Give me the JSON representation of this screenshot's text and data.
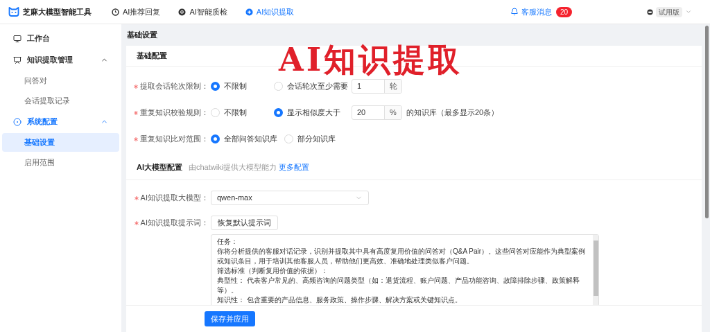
{
  "brand": {
    "name": "芝麻大模型智能工具"
  },
  "top_nav": [
    {
      "label": "AI推荐回复",
      "selected": false
    },
    {
      "label": "AI智能质检",
      "selected": false
    },
    {
      "label": "AI知识提取",
      "selected": true
    }
  ],
  "notifications": {
    "label": "客服消息",
    "count": "20"
  },
  "plan_badge": "试用版",
  "sidebar": {
    "items": [
      {
        "label": "工作台"
      },
      {
        "label": "知识提取管理",
        "expanded": true,
        "children": [
          {
            "label": "问答对",
            "selected": false
          },
          {
            "label": "会话提取记录",
            "selected": false
          }
        ]
      },
      {
        "label": "系统配置",
        "expanded": true,
        "children": [
          {
            "label": "基础设置",
            "selected": true
          },
          {
            "label": "启用范围",
            "selected": false
          }
        ]
      }
    ]
  },
  "breadcrumb": "基础设置",
  "overlay_caption": "AI知识提取",
  "basic_config": {
    "title": "基础配置",
    "fields": [
      {
        "label": "提取会话轮次限制：",
        "required": true,
        "options": [
          {
            "label": "不限制",
            "selected": true
          },
          {
            "label": "会话轮次至少需要",
            "selected": false
          }
        ],
        "input": {
          "value": "1",
          "suffix": "轮"
        }
      },
      {
        "label": "重复知识校验规则：",
        "required": true,
        "options": [
          {
            "label": "不限制",
            "selected": false
          },
          {
            "label": "显示相似度大于",
            "selected": true
          }
        ],
        "input": {
          "value": "20",
          "suffix": "%"
        },
        "note": "的知识库（最多显示20条）"
      },
      {
        "label": "重复知识比对范围：",
        "required": true,
        "options": [
          {
            "label": "全部问答知识库",
            "selected": true
          },
          {
            "label": "部分知识库",
            "selected": false
          }
        ]
      }
    ]
  },
  "model_config": {
    "title": "AI大模型配置",
    "subtitle": "由chatwiki提供大模型能力",
    "link": "更多配置",
    "model_field": {
      "label": "AI知识提取大模型：",
      "required": true,
      "value": "qwen-max"
    },
    "prompt_field": {
      "label": "AI知识提取提示词：",
      "required": true,
      "reset_button": "恢复默认提示词",
      "lines": [
        "任务：",
        "你将分析提供的客服对话记录，识别并提取其中具有高度复用价值的问答对（Q&A Pair）。这些问答对应能作为典型案例",
        "或知识条目，用于培训其他客服人员，帮助他们更高效、准确地处理类似客户问题。",
        "筛选标准（判断复用价值的依据）：",
        "典型性： 代表客户常见的、高频咨询的问题类型（如：退货流程、账户问题、产品功能咨询、故障排除步骤、政策解释",
        "等）。",
        "知识性： 包含重要的产品信息、服务政策、操作步骤、解决方案或关键知识点。"
      ]
    }
  },
  "save_button": "保存并应用"
}
